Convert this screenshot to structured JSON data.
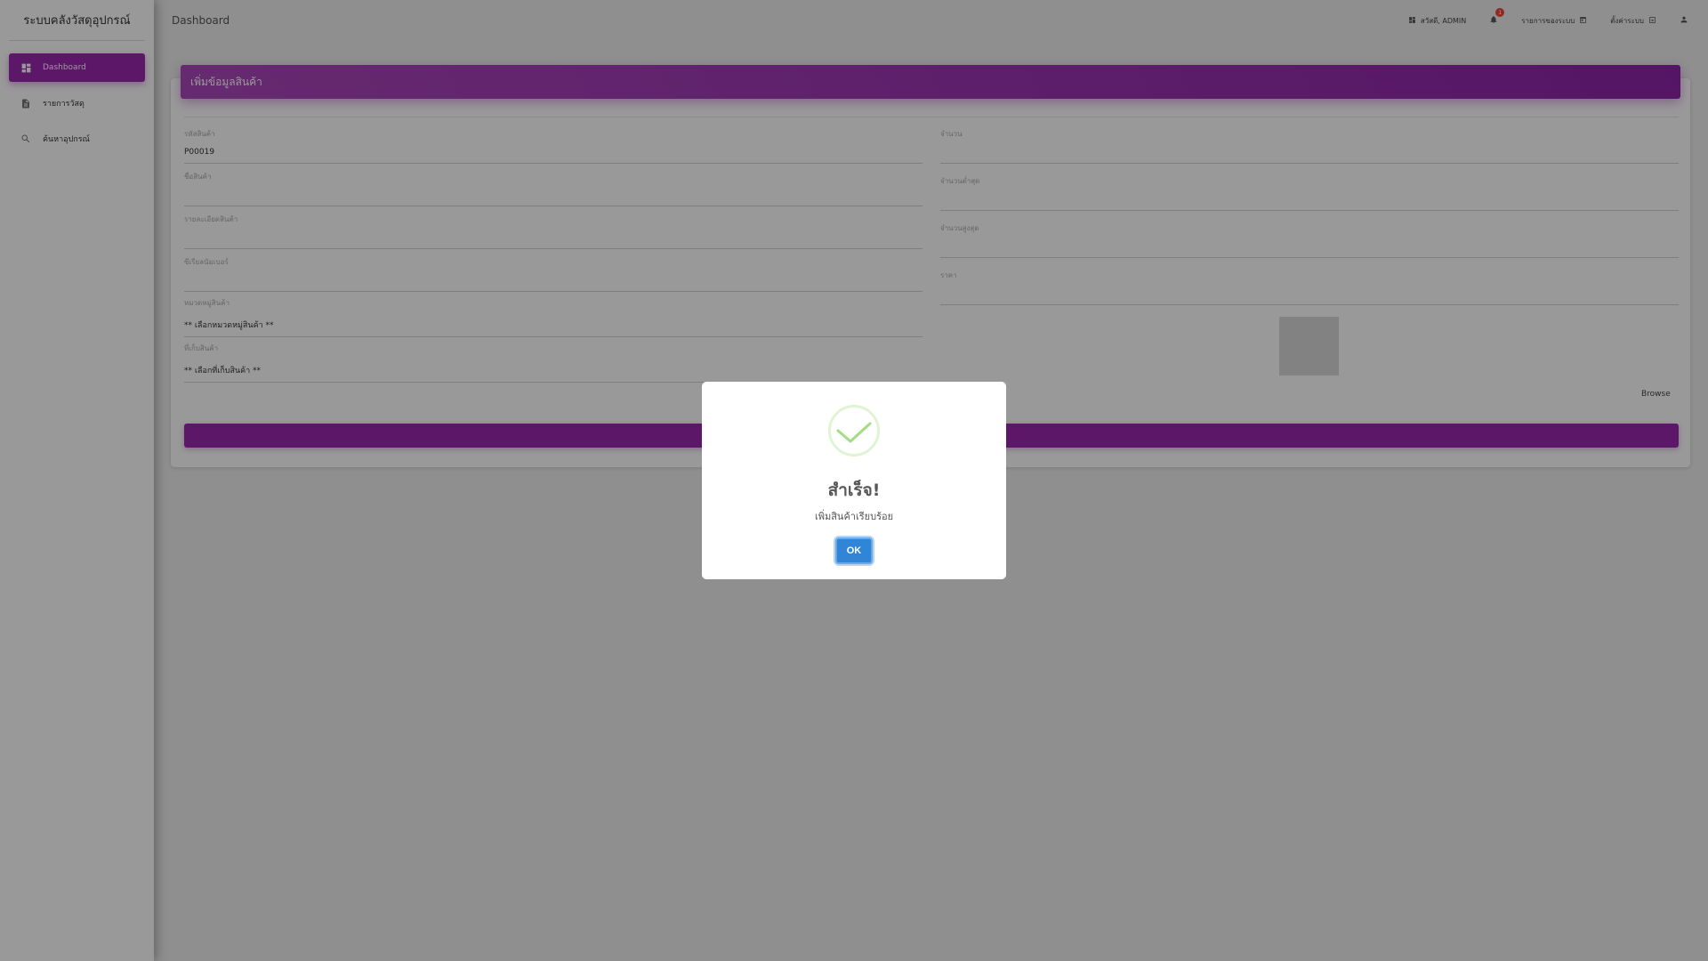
{
  "sidebar": {
    "brand": "ระบบคลังวัสดุอุปกรณ์",
    "items": [
      {
        "label": "Dashboard",
        "icon": "dashboard-icon"
      },
      {
        "label": "รายการวัสดุ",
        "icon": "document-icon"
      },
      {
        "label": "ค้นหาอุปกรณ์",
        "icon": "search-icon"
      }
    ]
  },
  "topbar": {
    "breadcrumb": "Dashboard",
    "user_label": "สวัสดี, ADMIN",
    "notification_count": "1",
    "report_label": "รายการของระบบ",
    "settings_label": "ตั้งค่าระบบ"
  },
  "form": {
    "title": "เพิ่มข้อมูลสินค้า",
    "product_code": {
      "label": "รหัสสินค้า",
      "value": "P00019"
    },
    "product_name": {
      "label": "ชื่อสินค้า",
      "value": ""
    },
    "product_detail": {
      "label": "รายละเอียดสินค้า",
      "value": ""
    },
    "serial_number": {
      "label": "ซีเรียลนัมเบอร์",
      "value": ""
    },
    "category": {
      "label": "หมวดหมู่สินค้า",
      "value": "** เลือกหมวดหมู่สินค้า **"
    },
    "storage": {
      "label": "ที่เก็บสินค้า",
      "value": "** เลือกที่เก็บสินค้า **"
    },
    "quantity": {
      "label": "จำนวน",
      "value": ""
    },
    "min_quantity": {
      "label": "จำนวนต่ำสุด",
      "value": ""
    },
    "max_quantity": {
      "label": "จำนวนสูงสุด",
      "value": ""
    },
    "price": {
      "label": "ราคา",
      "value": ""
    },
    "browse_label": "Browse"
  },
  "modal": {
    "title": "สำเร็จ!",
    "message": "เพิ่มสินค้าเรียบร้อย",
    "ok_label": "OK",
    "success_color": "#a5dc86",
    "button_color": "#3085d6"
  },
  "colors": {
    "accent": "#9c27b0",
    "badge": "#f44336"
  }
}
